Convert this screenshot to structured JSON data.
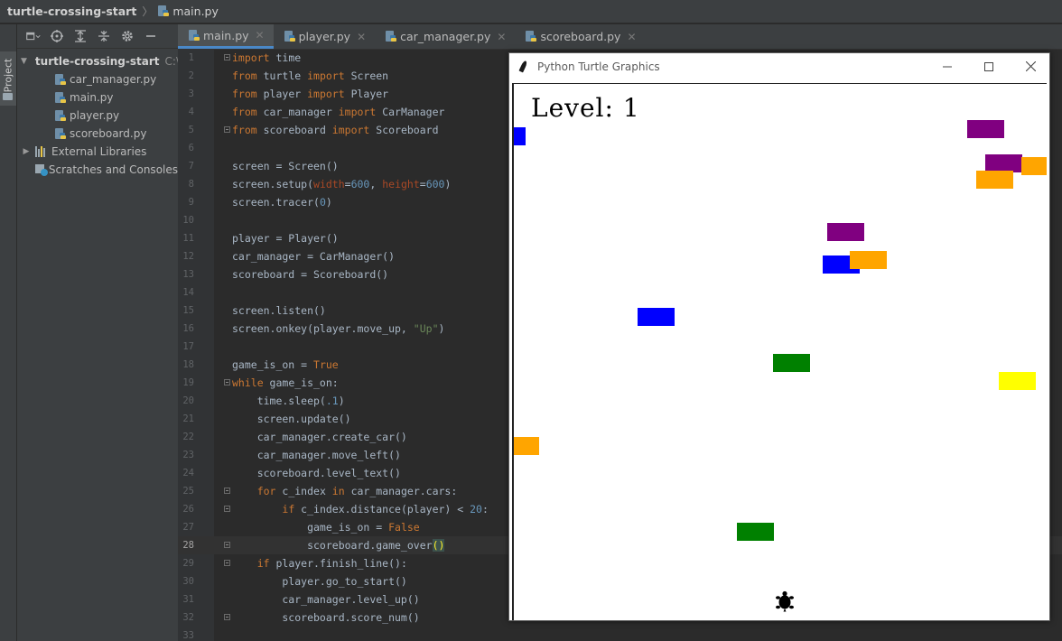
{
  "nav": {
    "project": "turtle-crossing-start",
    "file": "main.py"
  },
  "tool_window": {
    "label": "Project"
  },
  "project_tree": {
    "root": {
      "name": "turtle-crossing-start",
      "path": "C:\\"
    },
    "files": [
      "car_manager.py",
      "main.py",
      "player.py",
      "scoreboard.py"
    ],
    "external_libraries": "External Libraries",
    "scratches": "Scratches and Consoles"
  },
  "editor_tabs": [
    {
      "label": "main.py",
      "active": true
    },
    {
      "label": "player.py",
      "active": false
    },
    {
      "label": "car_manager.py",
      "active": false
    },
    {
      "label": "scoreboard.py",
      "active": false
    }
  ],
  "code": {
    "current_line": 28,
    "lines": [
      {
        "n": 1,
        "text": "import time"
      },
      {
        "n": 2,
        "text": "from turtle import Screen"
      },
      {
        "n": 3,
        "text": "from player import Player"
      },
      {
        "n": 4,
        "text": "from car_manager import CarManager"
      },
      {
        "n": 5,
        "text": "from scoreboard import Scoreboard"
      },
      {
        "n": 6,
        "text": ""
      },
      {
        "n": 7,
        "text": "screen = Screen()"
      },
      {
        "n": 8,
        "text": "screen.setup(width=600, height=600)"
      },
      {
        "n": 9,
        "text": "screen.tracer(0)"
      },
      {
        "n": 10,
        "text": ""
      },
      {
        "n": 11,
        "text": "player = Player()"
      },
      {
        "n": 12,
        "text": "car_manager = CarManager()"
      },
      {
        "n": 13,
        "text": "scoreboard = Scoreboard()"
      },
      {
        "n": 14,
        "text": ""
      },
      {
        "n": 15,
        "text": "screen.listen()"
      },
      {
        "n": 16,
        "text": "screen.onkey(player.move_up, \"Up\")"
      },
      {
        "n": 17,
        "text": ""
      },
      {
        "n": 18,
        "text": "game_is_on = True"
      },
      {
        "n": 19,
        "text": "while game_is_on:"
      },
      {
        "n": 20,
        "text": "    time.sleep(.1)"
      },
      {
        "n": 21,
        "text": "    screen.update()"
      },
      {
        "n": 22,
        "text": "    car_manager.create_car()"
      },
      {
        "n": 23,
        "text": "    car_manager.move_left()"
      },
      {
        "n": 24,
        "text": "    scoreboard.level_text()"
      },
      {
        "n": 25,
        "text": "    for c_index in car_manager.cars:"
      },
      {
        "n": 26,
        "text": "        if c_index.distance(player) < 20:"
      },
      {
        "n": 27,
        "text": "            game_is_on = False"
      },
      {
        "n": 28,
        "text": "            scoreboard.game_over()"
      },
      {
        "n": 29,
        "text": "    if player.finish_line():"
      },
      {
        "n": 30,
        "text": "        player.go_to_start()"
      },
      {
        "n": 31,
        "text": "        car_manager.level_up()"
      },
      {
        "n": 32,
        "text": "        scoreboard.score_num()"
      },
      {
        "n": 33,
        "text": ""
      }
    ]
  },
  "turtle_window": {
    "title": "Python Turtle Graphics",
    "level_text": "Level: 1",
    "colors": {
      "blue": "#0000ff",
      "purple": "#800080",
      "orange": "#ffa500",
      "green": "#008000",
      "yellow": "#ffff00",
      "player": "#000000"
    }
  }
}
